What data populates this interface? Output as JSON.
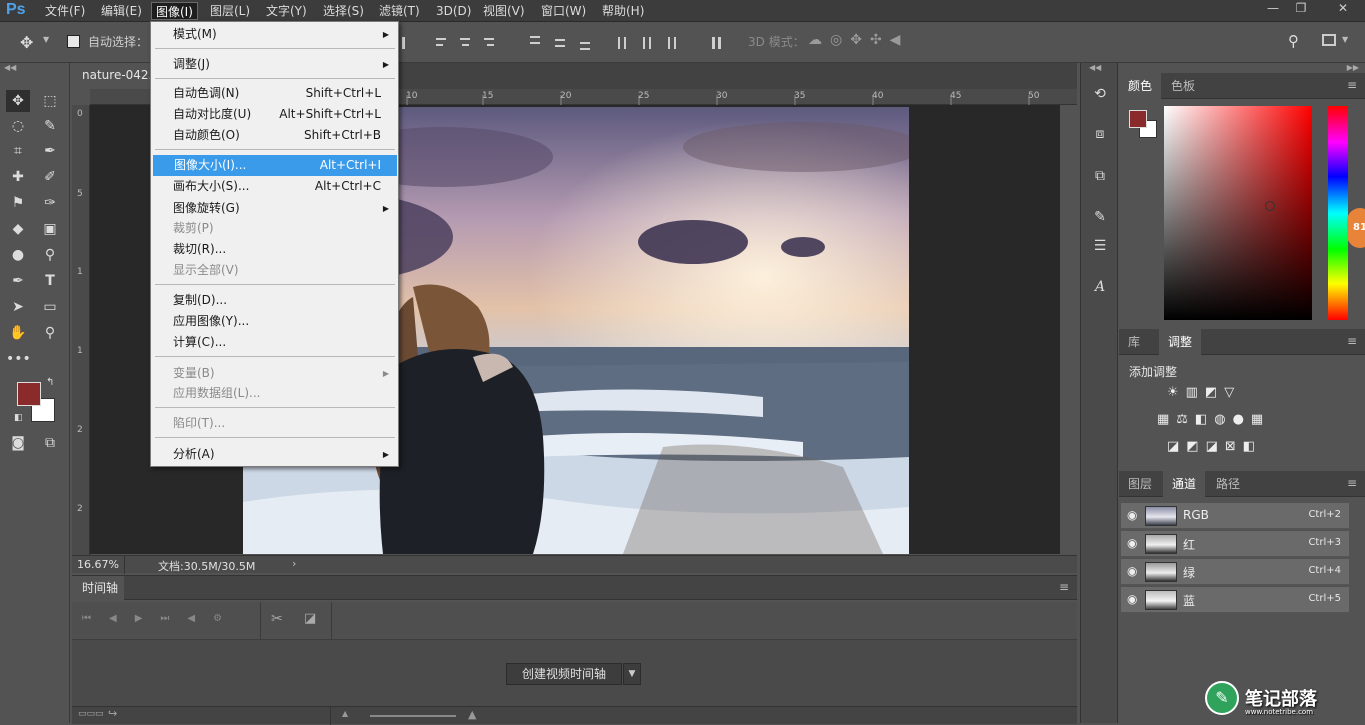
{
  "app": {
    "logo": "Ps"
  },
  "menubar": [
    "文件(F)",
    "编辑(E)",
    "图像(I)",
    "图层(L)",
    "文字(Y)",
    "选择(S)",
    "滤镜(T)",
    "3D(D)",
    "视图(V)",
    "窗口(W)",
    "帮助(H)"
  ],
  "window_controls": [
    "—",
    "❐",
    "✕"
  ],
  "options": {
    "auto_select": "自动选择：",
    "mode_3d": "3D 模式："
  },
  "document": {
    "tab": "nature-042.j",
    "zoom": "16.67%",
    "doc_info": "文档:30.5M/30.5M"
  },
  "ruler": {
    "h": [
      "10",
      "15",
      "20",
      "25",
      "30",
      "35",
      "40",
      "45",
      "50"
    ],
    "v": [
      "0",
      "5",
      "1",
      "1",
      "2",
      "2"
    ]
  },
  "image_menu": {
    "items": [
      {
        "label": "模式(M)",
        "shortcut": "",
        "submenu": true,
        "disabled": false
      },
      {
        "label": "调整(J)",
        "shortcut": "",
        "submenu": true,
        "disabled": false
      },
      {
        "label": "自动色调(N)",
        "shortcut": "Shift+Ctrl+L",
        "submenu": false,
        "disabled": false
      },
      {
        "label": "自动对比度(U)",
        "shortcut": "Alt+Shift+Ctrl+L",
        "submenu": false,
        "disabled": false
      },
      {
        "label": "自动颜色(O)",
        "shortcut": "Shift+Ctrl+B",
        "submenu": false,
        "disabled": false
      },
      {
        "label": "图像大小(I)...",
        "shortcut": "Alt+Ctrl+I",
        "submenu": false,
        "disabled": false
      },
      {
        "label": "画布大小(S)...",
        "shortcut": "Alt+Ctrl+C",
        "submenu": false,
        "disabled": false
      },
      {
        "label": "图像旋转(G)",
        "shortcut": "",
        "submenu": true,
        "disabled": false
      },
      {
        "label": "裁剪(P)",
        "shortcut": "",
        "submenu": false,
        "disabled": true
      },
      {
        "label": "裁切(R)...",
        "shortcut": "",
        "submenu": false,
        "disabled": false
      },
      {
        "label": "显示全部(V)",
        "shortcut": "",
        "submenu": false,
        "disabled": true
      },
      {
        "label": "复制(D)...",
        "shortcut": "",
        "submenu": false,
        "disabled": false
      },
      {
        "label": "应用图像(Y)...",
        "shortcut": "",
        "submenu": false,
        "disabled": false
      },
      {
        "label": "计算(C)...",
        "shortcut": "",
        "submenu": false,
        "disabled": false
      },
      {
        "label": "变量(B)",
        "shortcut": "",
        "submenu": true,
        "disabled": true
      },
      {
        "label": "应用数据组(L)...",
        "shortcut": "",
        "submenu": false,
        "disabled": true
      },
      {
        "label": "陷印(T)...",
        "shortcut": "",
        "submenu": false,
        "disabled": true
      },
      {
        "label": "分析(A)",
        "shortcut": "",
        "submenu": true,
        "disabled": false
      }
    ],
    "highlighted": "图像大小(I)..."
  },
  "timeline": {
    "title": "时间轴",
    "create_button": "创建视频时间轴"
  },
  "color_panel": {
    "tabs": [
      "颜色",
      "色板"
    ],
    "foreground": "#8b2a2a",
    "background": "#ffffff"
  },
  "adjust_panel": {
    "tabs": [
      "库",
      "调整"
    ],
    "title": "添加调整"
  },
  "channels_panel": {
    "tabs": [
      "图层",
      "通道",
      "路径"
    ],
    "channels": [
      {
        "name": "RGB",
        "shortcut": "Ctrl+2"
      },
      {
        "name": "红",
        "shortcut": "Ctrl+3"
      },
      {
        "name": "绿",
        "shortcut": "Ctrl+4"
      },
      {
        "name": "蓝",
        "shortcut": "Ctrl+5"
      }
    ]
  },
  "watermark": {
    "text": "笔记部落",
    "url": "www.notetribe.com",
    "badge": "81"
  }
}
